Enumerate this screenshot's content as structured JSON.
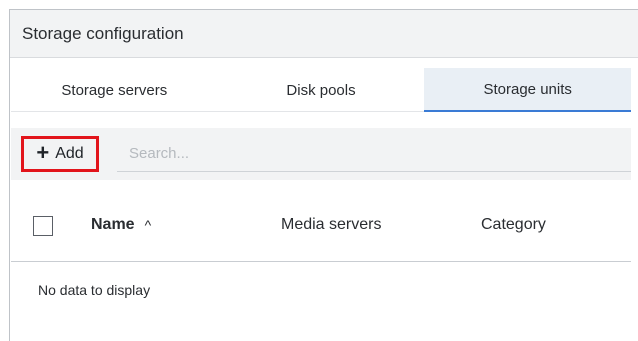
{
  "panel": {
    "title": "Storage configuration"
  },
  "tabs": [
    {
      "label": "Storage servers",
      "active": false
    },
    {
      "label": "Disk pools",
      "active": false
    },
    {
      "label": "Storage units",
      "active": true
    }
  ],
  "toolbar": {
    "add_label": "Add",
    "search_placeholder": "Search..."
  },
  "table": {
    "columns": [
      {
        "label": "Name",
        "sort": "ascending"
      },
      {
        "label": "Media servers"
      },
      {
        "label": "Category"
      }
    ],
    "empty_message": "No data to display"
  },
  "colors": {
    "highlight": "#e2141b",
    "active_tab_underline": "#3a7bd5"
  },
  "icons": [
    "plus-icon",
    "sort-ascending-icon",
    "checkbox-icon"
  ]
}
